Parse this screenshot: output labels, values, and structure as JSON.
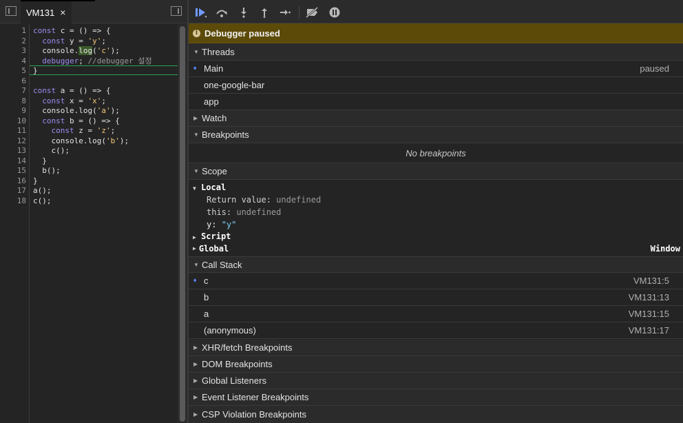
{
  "editor": {
    "tab_label": "VM131",
    "tab_close": "×",
    "lines": [
      {
        "n": "1",
        "t": [
          [
            "kw",
            "const"
          ],
          [
            "",
            "c"
          ],
          [
            "",
            ""
          ],
          [
            "",
            "= () => {"
          ]
        ]
      }
    ]
  },
  "code_lines": [
    "1",
    "2",
    "3",
    "4",
    "5",
    "6",
    "7",
    "8",
    "9",
    "10",
    "11",
    "12",
    "13",
    "14",
    "15",
    "16",
    "17",
    "18"
  ],
  "code": {
    "l1": {
      "a": "const",
      " b": " c = () => {"
    },
    "l1_kw": "const",
    "l1_rest": " c = () => {",
    "l2_kw": "const",
    "l2_mid": " y = ",
    "l2_str": "'y'",
    "l2_end": ";",
    "l3_a": "console.",
    "l3_hl": "log",
    "l3_b": "(",
    "l3_str": "'c'",
    "l3_end": ");",
    "l4_kw": "debugger",
    "l4_mid": "; ",
    "l4_cm": "//debugger 설정",
    "l5": "}",
    "l7_kw": "const",
    "l7_rest": " a = () => {",
    "l8_kw": "const",
    "l8_mid": " x = ",
    "l8_str": "'x'",
    "l8_end": ";",
    "l9_a": "console.log(",
    "l9_str": "'a'",
    "l9_end": ");",
    "l10_kw": "const",
    "l10_rest": " b = () => {",
    "l11_kw": "const",
    "l11_mid": " z = ",
    "l11_str": "'z'",
    "l11_end": ";",
    "l12_a": "console.log(",
    "l12_str": "'b'",
    "l12_end": ");",
    "l13": "c();",
    "l14": "}",
    "l15": "b();",
    "l16": "}",
    "l17": "a();",
    "l18": "c();"
  },
  "toolbar": {
    "resume_icon": "resume-icon",
    "step_over_icon": "step-over-icon",
    "step_into_icon": "step-into-icon",
    "step_out_icon": "step-out-icon",
    "step_icon": "step-icon",
    "deactivate_icon": "deactivate-breakpoints-icon",
    "pause_exceptions_icon": "pause-on-exceptions-icon"
  },
  "banner": {
    "text": "Debugger paused",
    "info": "i"
  },
  "threads": {
    "title": "Threads",
    "items": [
      {
        "name": "Main",
        "status": "paused"
      },
      {
        "name": "one-google-bar",
        "status": ""
      },
      {
        "name": "app",
        "status": ""
      }
    ]
  },
  "watch": {
    "title": "Watch"
  },
  "breakpoints": {
    "title": "Breakpoints",
    "empty": "No breakpoints"
  },
  "scope": {
    "title": "Scope",
    "local_label": "Local",
    "return_key": "Return value: ",
    "return_val": "undefined",
    "this_key": "this: ",
    "this_val": "undefined",
    "y_key": "y: ",
    "y_val": "\"y\"",
    "script_label": "Script",
    "global_label": "Global",
    "global_val": "Window"
  },
  "call_stack": {
    "title": "Call Stack",
    "frames": [
      {
        "name": "c",
        "loc": "VM131:5"
      },
      {
        "name": "b",
        "loc": "VM131:13"
      },
      {
        "name": "a",
        "loc": "VM131:15"
      },
      {
        "name": "(anonymous)",
        "loc": "VM131:17"
      }
    ]
  },
  "other_sections": [
    "XHR/fetch Breakpoints",
    "DOM Breakpoints",
    "Global Listeners",
    "Event Listener Breakpoints",
    "CSP Violation Breakpoints"
  ],
  "colors": {
    "accent": "#5a86ff",
    "banner": "#5c4a09",
    "keyword": "#9a8ef0",
    "string": "#f4c87b"
  }
}
